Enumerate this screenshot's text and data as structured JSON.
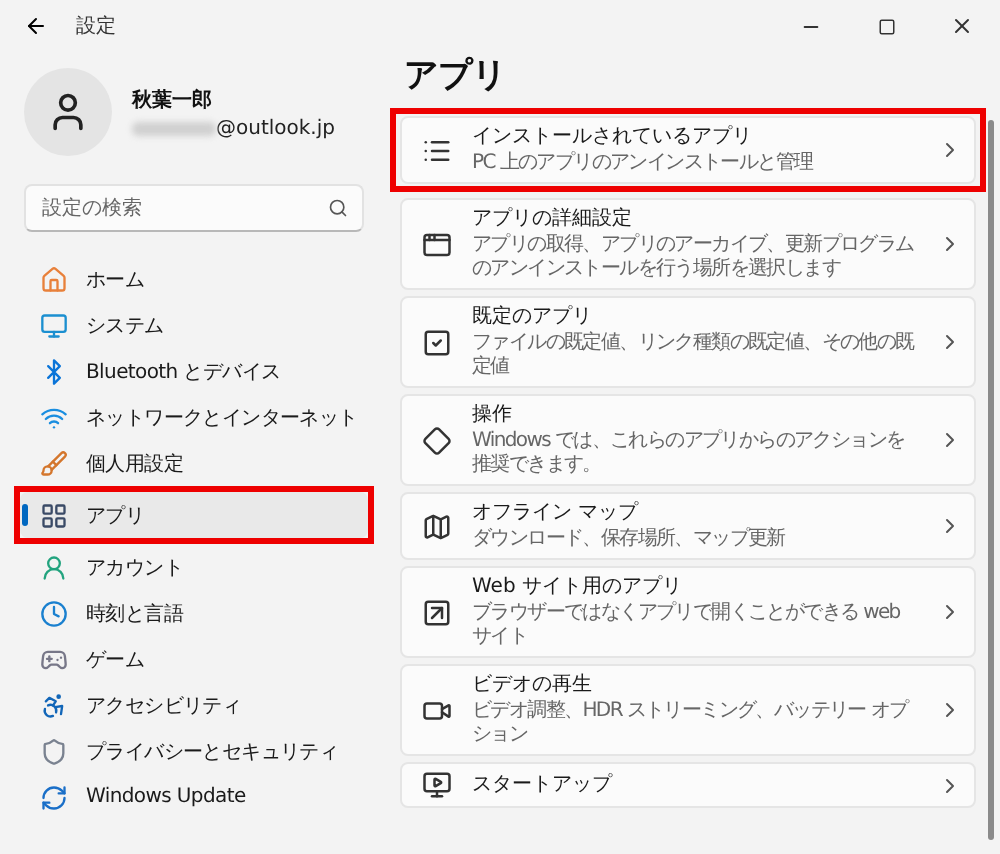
{
  "window": {
    "title": "設定"
  },
  "account": {
    "name": "秋葉一郎",
    "email": "@outlook.jp"
  },
  "search": {
    "placeholder": "設定の検索"
  },
  "sidebar": {
    "items": [
      {
        "label": "ホーム",
        "selected": false,
        "highlighted": false
      },
      {
        "label": "システム",
        "selected": false,
        "highlighted": false
      },
      {
        "label": "Bluetooth とデバイス",
        "selected": false,
        "highlighted": false
      },
      {
        "label": "ネットワークとインターネット",
        "selected": false,
        "highlighted": false
      },
      {
        "label": "個人用設定",
        "selected": false,
        "highlighted": false
      },
      {
        "label": "アプリ",
        "selected": true,
        "highlighted": true
      },
      {
        "label": "アカウント",
        "selected": false,
        "highlighted": false
      },
      {
        "label": "時刻と言語",
        "selected": false,
        "highlighted": false
      },
      {
        "label": "ゲーム",
        "selected": false,
        "highlighted": false
      },
      {
        "label": "アクセシビリティ",
        "selected": false,
        "highlighted": false
      },
      {
        "label": "プライバシーとセキュリティ",
        "selected": false,
        "highlighted": false
      },
      {
        "label": "Windows Update",
        "selected": false,
        "highlighted": false
      }
    ]
  },
  "page": {
    "title": "アプリ",
    "cards": [
      {
        "title": "インストールされているアプリ",
        "description": "PC 上のアプリのアンインストールと管理",
        "highlighted": true
      },
      {
        "title": "アプリの詳細設定",
        "description": "アプリの取得、アプリのアーカイブ、更新プログラムのアンインストールを行う場所を選択します",
        "highlighted": false
      },
      {
        "title": "既定のアプリ",
        "description": "ファイルの既定値、リンク種類の既定値、その他の既定値",
        "highlighted": false
      },
      {
        "title": "操作",
        "description": "Windows では、これらのアプリからのアクションを推奨できます。",
        "highlighted": false
      },
      {
        "title": "オフライン マップ",
        "description": "ダウンロード、保存場所、マップ更新",
        "highlighted": false
      },
      {
        "title": "Web サイト用のアプリ",
        "description": "ブラウザーではなくアプリで開くことができる web サイト",
        "highlighted": false
      },
      {
        "title": "ビデオの再生",
        "description": "ビデオ調整、HDR ストリーミング、バッテリー オプション",
        "highlighted": false
      },
      {
        "title": "スタートアップ",
        "highlighted": false
      }
    ]
  }
}
